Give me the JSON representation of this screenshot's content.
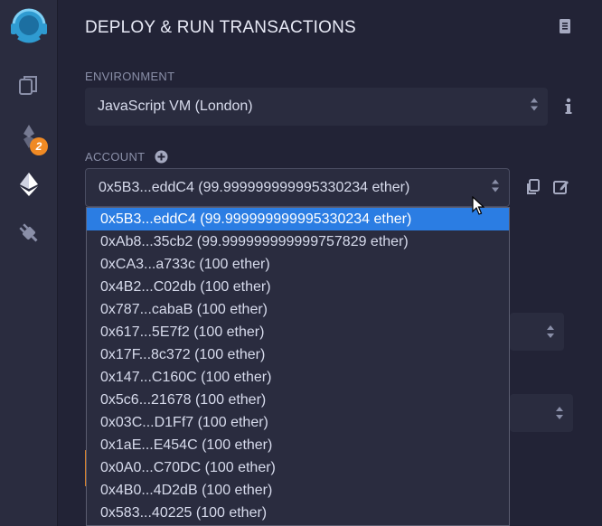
{
  "sidebar": {
    "logo_icon": "remix-logo-icon",
    "items": [
      {
        "icon": "file-explorer-icon"
      },
      {
        "icon": "solidity-compiler-icon",
        "badge": "2"
      },
      {
        "icon": "ethereum-deploy-icon",
        "active": true
      },
      {
        "icon": "plugin-manager-icon"
      }
    ]
  },
  "panel": {
    "title": "DEPLOY & RUN TRANSACTIONS",
    "environment_label": "ENVIRONMENT",
    "environment_value": "JavaScript VM (London)",
    "account_label": "ACCOUNT",
    "account_value": "0x5B3...eddC4 (99.999999999995330234 ether)"
  },
  "account_dropdown": {
    "selected_index": 0,
    "options": [
      "0x5B3...eddC4 (99.999999999995330234 ether)",
      "0xAb8...35cb2 (99.999999999999757829 ether)",
      "0xCA3...a733c (100 ether)",
      "0x4B2...C02db (100 ether)",
      "0x787...cabaB (100 ether)",
      "0x617...5E7f2 (100 ether)",
      "0x17F...8c372 (100 ether)",
      "0x147...C160C (100 ether)",
      "0x5c6...21678 (100 ether)",
      "0x03C...D1Ff7 (100 ether)",
      "0x1aE...E454C (100 ether)",
      "0x0A0...C70DC (100 ether)",
      "0x4B0...4D2dB (100 ether)",
      "0x583...40225 (100 ether)"
    ]
  },
  "colors": {
    "accent": "#2b7de3",
    "badge": "#f08a24",
    "active_icon": "#ffffff",
    "logo": "#2f9bd1"
  }
}
